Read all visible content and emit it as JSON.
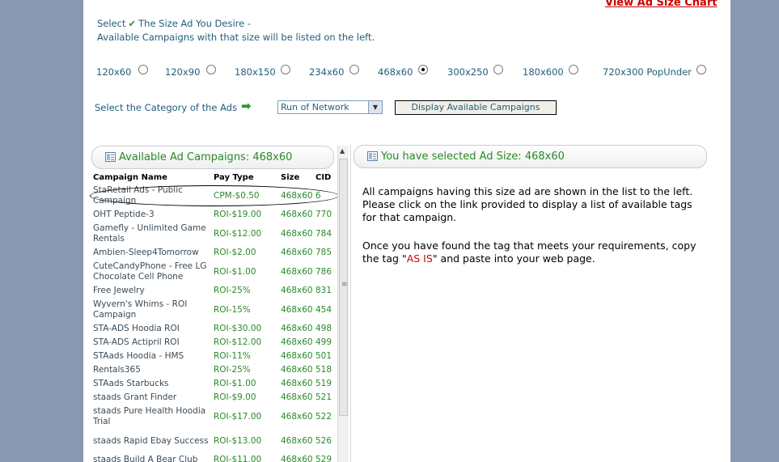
{
  "header": {
    "chart_link": "View Ad Size Chart",
    "intro_select": "Select",
    "intro_desire": "The Size Ad You Desire -",
    "intro_line2": "Available Campaigns with that size will be listed on the left."
  },
  "sizes": [
    {
      "label": "120x60",
      "selected": false
    },
    {
      "label": "120x90",
      "selected": false
    },
    {
      "label": "180x150",
      "selected": false
    },
    {
      "label": "234x60",
      "selected": false
    },
    {
      "label": "468x60",
      "selected": true
    },
    {
      "label": "300x250",
      "selected": false
    },
    {
      "label": "180x600",
      "selected": false
    },
    {
      "label": "720x300 PopUnder",
      "selected": false
    }
  ],
  "category": {
    "label": "Select the Category of the Ads",
    "selected": "Run of Network",
    "button": "Display Available Campaigns"
  },
  "left_panel": {
    "title": "Available Ad Campaigns: 468x60",
    "columns": [
      "Campaign Name",
      "Pay Type",
      "Size",
      "CID"
    ],
    "rows": [
      {
        "name": "StaRetail Ads - Public Campaign",
        "pay": "CPM-$0.50",
        "size": "468x60",
        "cid": "6"
      },
      {
        "name": "OHT Peptide-3",
        "pay": "ROI-$19.00",
        "size": "468x60",
        "cid": "770"
      },
      {
        "name": "Gamefly - Unlimited Game Rentals",
        "pay": "ROI-$12.00",
        "size": "468x60",
        "cid": "784"
      },
      {
        "name": "Ambien-Sleep4Tomorrow",
        "pay": "ROI-$2.00",
        "size": "468x60",
        "cid": "785"
      },
      {
        "name": "CuteCandyPhone - Free LG Chocolate Cell Phone",
        "pay": "ROI-$1.00",
        "size": "468x60",
        "cid": "786"
      },
      {
        "name": "Free Jewelry",
        "pay": "ROI-25%",
        "size": "468x60",
        "cid": "831"
      },
      {
        "name": "Wyvern's Whims - ROI Campaign",
        "pay": "ROI-15%",
        "size": "468x60",
        "cid": "454"
      },
      {
        "name": "STA-ADS Hoodia ROI",
        "pay": "ROI-$30.00",
        "size": "468x60",
        "cid": "498"
      },
      {
        "name": "STA-ADS Actipril ROI",
        "pay": "ROI-$12.00",
        "size": "468x60",
        "cid": "499"
      },
      {
        "name": "STAads Hoodia - HMS",
        "pay": "ROI-11%",
        "size": "468x60",
        "cid": "501"
      },
      {
        "name": "Rentals365",
        "pay": "ROI-25%",
        "size": "468x60",
        "cid": "518"
      },
      {
        "name": "STAads Starbucks",
        "pay": "ROI-$1.00",
        "size": "468x60",
        "cid": "519"
      },
      {
        "name": "staads Grant Finder",
        "pay": "ROI-$9.00",
        "size": "468x60",
        "cid": "521"
      },
      {
        "name": "staads Pure Health Hoodia Trial",
        "pay": "ROI-$17.00",
        "size": "468x60",
        "cid": "522"
      },
      {
        "name": "staads Rapid Ebay Success",
        "pay": "ROI-$13.00",
        "size": "468x60",
        "cid": "526"
      },
      {
        "name": "staads Build A Bear Club",
        "pay": "ROI-$11.00",
        "size": "468x60",
        "cid": "529"
      }
    ]
  },
  "right_panel": {
    "title": "You have selected Ad Size: 468x60",
    "para1": "All campaigns having this size ad are shown in the list to the left. Please click on the link provided to display a list of available tags for that campaign.",
    "para2_before": "Once you have found the tag that meets your requirements, copy the tag \"",
    "para2_highlight": "AS IS",
    "para2_after": "\" and paste into your web page."
  }
}
